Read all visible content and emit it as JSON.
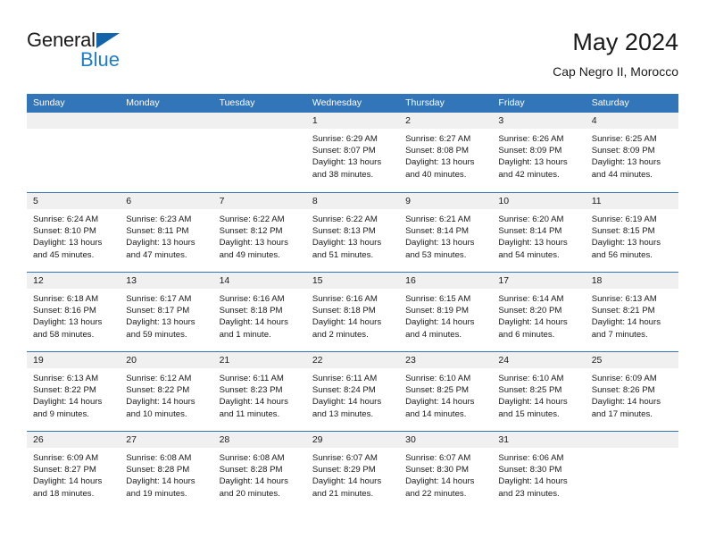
{
  "brand": {
    "name_top": "General",
    "name_bottom": "Blue",
    "accent_dark": "#1464aa",
    "accent_light": "#1e7ec8"
  },
  "header": {
    "title": "May 2024",
    "subtitle": "Cap Negro II, Morocco"
  },
  "theme": {
    "header_blue": "#3275b8",
    "daynum_band": "#f0f0f0",
    "text": "#1a1a1a"
  },
  "weekdays": [
    "Sunday",
    "Monday",
    "Tuesday",
    "Wednesday",
    "Thursday",
    "Friday",
    "Saturday"
  ],
  "weeks": [
    [
      {
        "day": "",
        "sunrise": "",
        "sunset": "",
        "daylight1": "",
        "daylight2": ""
      },
      {
        "day": "",
        "sunrise": "",
        "sunset": "",
        "daylight1": "",
        "daylight2": ""
      },
      {
        "day": "",
        "sunrise": "",
        "sunset": "",
        "daylight1": "",
        "daylight2": ""
      },
      {
        "day": "1",
        "sunrise": "Sunrise: 6:29 AM",
        "sunset": "Sunset: 8:07 PM",
        "daylight1": "Daylight: 13 hours",
        "daylight2": "and 38 minutes."
      },
      {
        "day": "2",
        "sunrise": "Sunrise: 6:27 AM",
        "sunset": "Sunset: 8:08 PM",
        "daylight1": "Daylight: 13 hours",
        "daylight2": "and 40 minutes."
      },
      {
        "day": "3",
        "sunrise": "Sunrise: 6:26 AM",
        "sunset": "Sunset: 8:09 PM",
        "daylight1": "Daylight: 13 hours",
        "daylight2": "and 42 minutes."
      },
      {
        "day": "4",
        "sunrise": "Sunrise: 6:25 AM",
        "sunset": "Sunset: 8:09 PM",
        "daylight1": "Daylight: 13 hours",
        "daylight2": "and 44 minutes."
      }
    ],
    [
      {
        "day": "5",
        "sunrise": "Sunrise: 6:24 AM",
        "sunset": "Sunset: 8:10 PM",
        "daylight1": "Daylight: 13 hours",
        "daylight2": "and 45 minutes."
      },
      {
        "day": "6",
        "sunrise": "Sunrise: 6:23 AM",
        "sunset": "Sunset: 8:11 PM",
        "daylight1": "Daylight: 13 hours",
        "daylight2": "and 47 minutes."
      },
      {
        "day": "7",
        "sunrise": "Sunrise: 6:22 AM",
        "sunset": "Sunset: 8:12 PM",
        "daylight1": "Daylight: 13 hours",
        "daylight2": "and 49 minutes."
      },
      {
        "day": "8",
        "sunrise": "Sunrise: 6:22 AM",
        "sunset": "Sunset: 8:13 PM",
        "daylight1": "Daylight: 13 hours",
        "daylight2": "and 51 minutes."
      },
      {
        "day": "9",
        "sunrise": "Sunrise: 6:21 AM",
        "sunset": "Sunset: 8:14 PM",
        "daylight1": "Daylight: 13 hours",
        "daylight2": "and 53 minutes."
      },
      {
        "day": "10",
        "sunrise": "Sunrise: 6:20 AM",
        "sunset": "Sunset: 8:14 PM",
        "daylight1": "Daylight: 13 hours",
        "daylight2": "and 54 minutes."
      },
      {
        "day": "11",
        "sunrise": "Sunrise: 6:19 AM",
        "sunset": "Sunset: 8:15 PM",
        "daylight1": "Daylight: 13 hours",
        "daylight2": "and 56 minutes."
      }
    ],
    [
      {
        "day": "12",
        "sunrise": "Sunrise: 6:18 AM",
        "sunset": "Sunset: 8:16 PM",
        "daylight1": "Daylight: 13 hours",
        "daylight2": "and 58 minutes."
      },
      {
        "day": "13",
        "sunrise": "Sunrise: 6:17 AM",
        "sunset": "Sunset: 8:17 PM",
        "daylight1": "Daylight: 13 hours",
        "daylight2": "and 59 minutes."
      },
      {
        "day": "14",
        "sunrise": "Sunrise: 6:16 AM",
        "sunset": "Sunset: 8:18 PM",
        "daylight1": "Daylight: 14 hours",
        "daylight2": "and 1 minute."
      },
      {
        "day": "15",
        "sunrise": "Sunrise: 6:16 AM",
        "sunset": "Sunset: 8:18 PM",
        "daylight1": "Daylight: 14 hours",
        "daylight2": "and 2 minutes."
      },
      {
        "day": "16",
        "sunrise": "Sunrise: 6:15 AM",
        "sunset": "Sunset: 8:19 PM",
        "daylight1": "Daylight: 14 hours",
        "daylight2": "and 4 minutes."
      },
      {
        "day": "17",
        "sunrise": "Sunrise: 6:14 AM",
        "sunset": "Sunset: 8:20 PM",
        "daylight1": "Daylight: 14 hours",
        "daylight2": "and 6 minutes."
      },
      {
        "day": "18",
        "sunrise": "Sunrise: 6:13 AM",
        "sunset": "Sunset: 8:21 PM",
        "daylight1": "Daylight: 14 hours",
        "daylight2": "and 7 minutes."
      }
    ],
    [
      {
        "day": "19",
        "sunrise": "Sunrise: 6:13 AM",
        "sunset": "Sunset: 8:22 PM",
        "daylight1": "Daylight: 14 hours",
        "daylight2": "and 9 minutes."
      },
      {
        "day": "20",
        "sunrise": "Sunrise: 6:12 AM",
        "sunset": "Sunset: 8:22 PM",
        "daylight1": "Daylight: 14 hours",
        "daylight2": "and 10 minutes."
      },
      {
        "day": "21",
        "sunrise": "Sunrise: 6:11 AM",
        "sunset": "Sunset: 8:23 PM",
        "daylight1": "Daylight: 14 hours",
        "daylight2": "and 11 minutes."
      },
      {
        "day": "22",
        "sunrise": "Sunrise: 6:11 AM",
        "sunset": "Sunset: 8:24 PM",
        "daylight1": "Daylight: 14 hours",
        "daylight2": "and 13 minutes."
      },
      {
        "day": "23",
        "sunrise": "Sunrise: 6:10 AM",
        "sunset": "Sunset: 8:25 PM",
        "daylight1": "Daylight: 14 hours",
        "daylight2": "and 14 minutes."
      },
      {
        "day": "24",
        "sunrise": "Sunrise: 6:10 AM",
        "sunset": "Sunset: 8:25 PM",
        "daylight1": "Daylight: 14 hours",
        "daylight2": "and 15 minutes."
      },
      {
        "day": "25",
        "sunrise": "Sunrise: 6:09 AM",
        "sunset": "Sunset: 8:26 PM",
        "daylight1": "Daylight: 14 hours",
        "daylight2": "and 17 minutes."
      }
    ],
    [
      {
        "day": "26",
        "sunrise": "Sunrise: 6:09 AM",
        "sunset": "Sunset: 8:27 PM",
        "daylight1": "Daylight: 14 hours",
        "daylight2": "and 18 minutes."
      },
      {
        "day": "27",
        "sunrise": "Sunrise: 6:08 AM",
        "sunset": "Sunset: 8:28 PM",
        "daylight1": "Daylight: 14 hours",
        "daylight2": "and 19 minutes."
      },
      {
        "day": "28",
        "sunrise": "Sunrise: 6:08 AM",
        "sunset": "Sunset: 8:28 PM",
        "daylight1": "Daylight: 14 hours",
        "daylight2": "and 20 minutes."
      },
      {
        "day": "29",
        "sunrise": "Sunrise: 6:07 AM",
        "sunset": "Sunset: 8:29 PM",
        "daylight1": "Daylight: 14 hours",
        "daylight2": "and 21 minutes."
      },
      {
        "day": "30",
        "sunrise": "Sunrise: 6:07 AM",
        "sunset": "Sunset: 8:30 PM",
        "daylight1": "Daylight: 14 hours",
        "daylight2": "and 22 minutes."
      },
      {
        "day": "31",
        "sunrise": "Sunrise: 6:06 AM",
        "sunset": "Sunset: 8:30 PM",
        "daylight1": "Daylight: 14 hours",
        "daylight2": "and 23 minutes."
      },
      {
        "day": "",
        "sunrise": "",
        "sunset": "",
        "daylight1": "",
        "daylight2": ""
      }
    ]
  ]
}
